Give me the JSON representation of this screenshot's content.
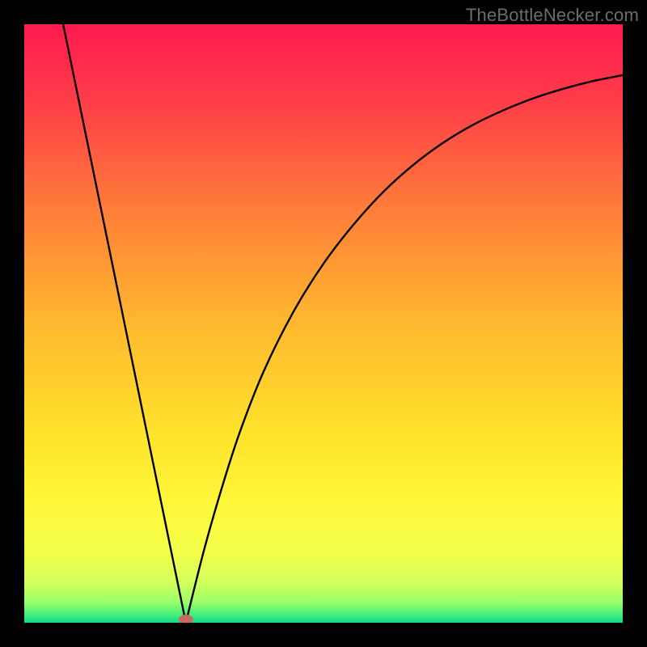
{
  "watermark_text": "TheBottleNecker.com",
  "chart_data": {
    "type": "line",
    "title": "",
    "xlabel": "",
    "ylabel": "",
    "xlim": [
      0,
      1
    ],
    "ylim": [
      0,
      1
    ],
    "notch_x": 0.27,
    "marker": {
      "x": 0.27,
      "y": 0.0,
      "color": "#c96a5c"
    },
    "curve_left": [
      {
        "x": 0.065,
        "y": 1.0
      },
      {
        "x": 0.27,
        "y": 0.0
      }
    ],
    "curve_right": [
      {
        "x": 0.27,
        "y": 0.0
      },
      {
        "x": 0.3,
        "y": 0.12
      },
      {
        "x": 0.33,
        "y": 0.225
      },
      {
        "x": 0.36,
        "y": 0.318
      },
      {
        "x": 0.4,
        "y": 0.42
      },
      {
        "x": 0.45,
        "y": 0.52
      },
      {
        "x": 0.5,
        "y": 0.6
      },
      {
        "x": 0.55,
        "y": 0.665
      },
      {
        "x": 0.6,
        "y": 0.72
      },
      {
        "x": 0.65,
        "y": 0.765
      },
      {
        "x": 0.7,
        "y": 0.802
      },
      {
        "x": 0.75,
        "y": 0.832
      },
      {
        "x": 0.8,
        "y": 0.856
      },
      {
        "x": 0.85,
        "y": 0.876
      },
      {
        "x": 0.9,
        "y": 0.892
      },
      {
        "x": 0.95,
        "y": 0.905
      },
      {
        "x": 1.0,
        "y": 0.915
      }
    ],
    "gradient_stops": [
      {
        "offset": 0.0,
        "color": "#ff1a4f"
      },
      {
        "offset": 0.12,
        "color": "#ff3a49"
      },
      {
        "offset": 0.3,
        "color": "#ff7a3a"
      },
      {
        "offset": 0.5,
        "color": "#ffb82f"
      },
      {
        "offset": 0.68,
        "color": "#ffe22b"
      },
      {
        "offset": 0.8,
        "color": "#fff73a"
      },
      {
        "offset": 0.88,
        "color": "#f4ff4a"
      },
      {
        "offset": 0.93,
        "color": "#d6ff5a"
      },
      {
        "offset": 0.965,
        "color": "#9cff6a"
      },
      {
        "offset": 0.985,
        "color": "#4cf07a"
      },
      {
        "offset": 1.0,
        "color": "#12d98a"
      }
    ]
  }
}
